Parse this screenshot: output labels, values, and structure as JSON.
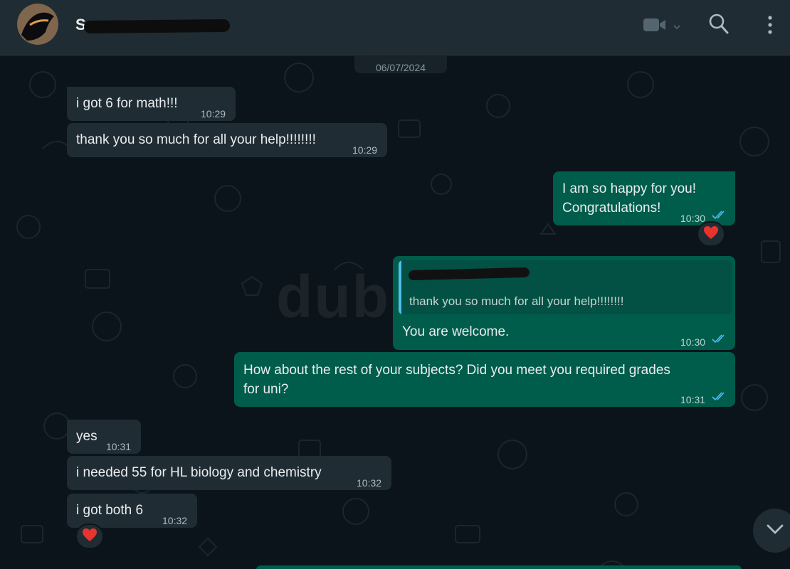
{
  "header": {
    "contact_name": "S",
    "icons": [
      "avatar",
      "video-call-icon",
      "chevron-down-icon",
      "search-icon",
      "menu-icon"
    ]
  },
  "chat": {
    "date_label": "06/07/2024",
    "watermark": "dubizzle",
    "messages": [
      {
        "dir": "in",
        "text": "i got 6 for math!!!",
        "time": "10:29"
      },
      {
        "dir": "in",
        "text": "thank you so much for all your help!!!!!!!!",
        "time": "10:29"
      },
      {
        "dir": "out",
        "lines": [
          "I am so happy for you!",
          "Congratulations!"
        ],
        "time": "10:30",
        "status": "read",
        "reaction": "heart"
      },
      {
        "dir": "out",
        "quoted": "thank you so much for all your help!!!!!!!!",
        "text": "You are welcome.",
        "time": "10:30",
        "status": "read"
      },
      {
        "dir": "out",
        "lines": [
          "How about the rest of your subjects? Did you meet you required grades",
          "for uni?"
        ],
        "time": "10:31",
        "status": "read"
      },
      {
        "dir": "in",
        "text": "yes",
        "time": "10:31"
      },
      {
        "dir": "in",
        "text": "i needed 55 for HL biology and chemistry",
        "time": "10:32"
      },
      {
        "dir": "in",
        "text": "i got both 6",
        "time": "10:32",
        "reaction": "heart"
      }
    ]
  },
  "colors": {
    "background": "#0b141a",
    "header": "#202c33",
    "incoming_bubble": "#202c33",
    "outgoing_bubble": "#005c4b",
    "read_tick": "#53bdeb",
    "reaction_heart": "#e8332f"
  }
}
